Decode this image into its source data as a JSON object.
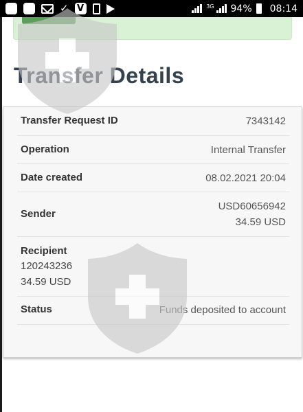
{
  "status_bar": {
    "battery_percent": "94%",
    "time": "08:14",
    "network_type": "3G",
    "left_icons": [
      "app-icon",
      "app-icon",
      "mail-icon",
      "download-check-icon",
      "v-app-icon",
      "phone-icon",
      "play-store-icon"
    ]
  },
  "page": {
    "title": "Transfer Details"
  },
  "details": {
    "request_id_label": "Transfer Request ID",
    "request_id_value": "7343142",
    "operation_label": "Operation",
    "operation_value": "Internal Transfer",
    "date_label": "Date created",
    "date_value": "08.02.2021 20:04",
    "sender_label": "Sender",
    "sender_account": "USD60656942",
    "sender_amount": "34.59 USD",
    "recipient_label": "Recipient",
    "recipient_account": "120243236",
    "recipient_amount": "34.59 USD",
    "status_label": "Status",
    "status_value": "Funds deposited to account"
  },
  "colors": {
    "title": "#344250",
    "alert_bg": "#d9f2d5",
    "alert_button": "#5ba05a",
    "card_bg": "#f7f7f7"
  }
}
